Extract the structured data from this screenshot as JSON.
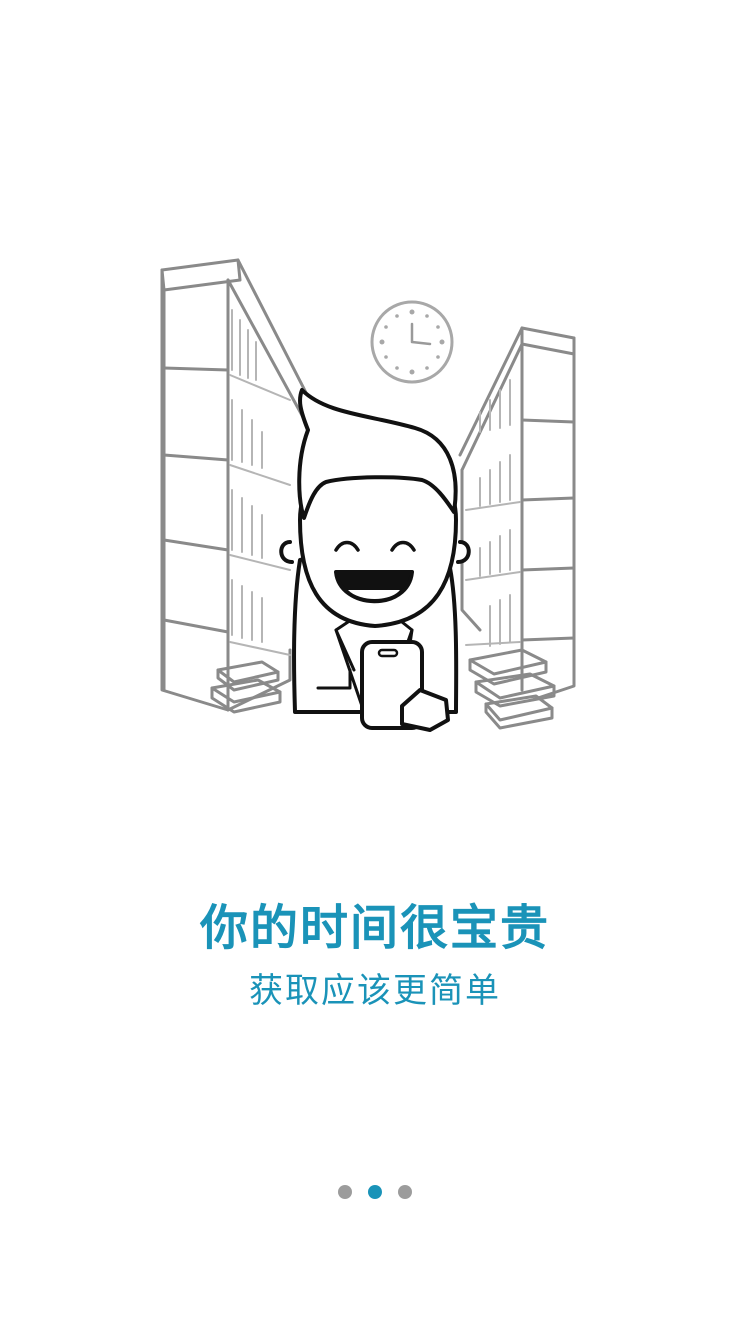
{
  "onboarding": {
    "title": "你的时间很宝贵",
    "subtitle": "获取应该更简单"
  },
  "pager": {
    "total": 3,
    "current_index": 1
  },
  "colors": {
    "accent": "#1a93b8",
    "dot_inactive": "#9c9c9c",
    "line_art": "#8a8a8a",
    "background": "#ffffff"
  },
  "illustration": {
    "icon": "library-reader-illustration"
  }
}
